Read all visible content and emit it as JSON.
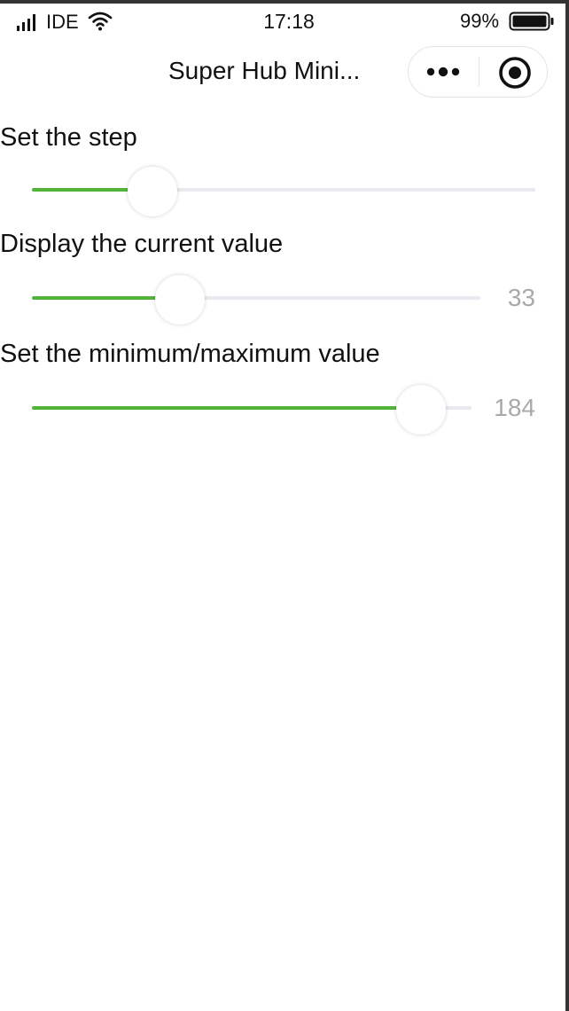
{
  "status_bar": {
    "carrier": "IDE",
    "time": "17:18",
    "battery_percent": "99%",
    "icons": [
      "signal-icon",
      "wifi-icon",
      "battery-icon"
    ]
  },
  "nav": {
    "title": "Super Hub Mini...",
    "icons": [
      "more-icon",
      "close-target-icon"
    ]
  },
  "sliders": [
    {
      "label": "Set the step",
      "level": 0.24,
      "value": null
    },
    {
      "label": "Display the current value",
      "level": 0.33,
      "value": "33"
    },
    {
      "label": "Set the minimum/maximum value",
      "level": 0.886,
      "value": "184"
    }
  ],
  "colors": {
    "accent": "#52b53a",
    "track": "#e9e9ef",
    "value_text": "#a9a9a9"
  }
}
